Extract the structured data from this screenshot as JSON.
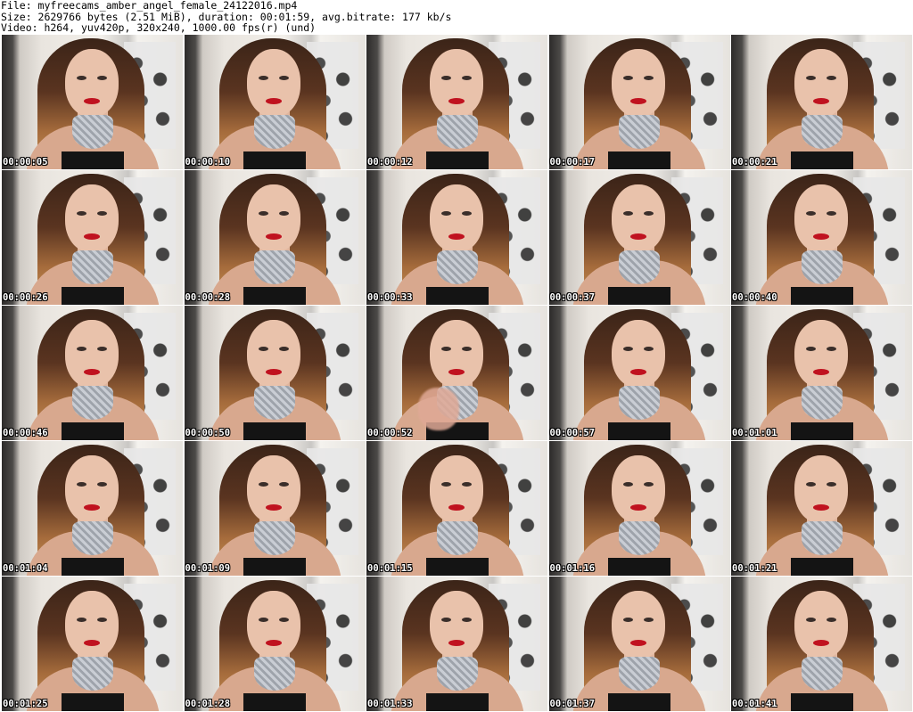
{
  "header": {
    "file_line": "File: myfreecams_amber_angel_female_24122016.mp4",
    "size_line": "Size: 2629766 bytes (2.51 MiB), duration: 00:01:59, avg.bitrate: 177 kb/s",
    "video_line": "Video: h264, yuv420p, 320x240, 1000.00 fps(r) (und)"
  },
  "thumbnails": [
    {
      "timestamp": "00:00:05"
    },
    {
      "timestamp": "00:00:10"
    },
    {
      "timestamp": "00:00:12"
    },
    {
      "timestamp": "00:00:17"
    },
    {
      "timestamp": "00:00:21"
    },
    {
      "timestamp": "00:00:26"
    },
    {
      "timestamp": "00:00:28"
    },
    {
      "timestamp": "00:00:33"
    },
    {
      "timestamp": "00:00:37"
    },
    {
      "timestamp": "00:00:40"
    },
    {
      "timestamp": "00:00:46"
    },
    {
      "timestamp": "00:00:50"
    },
    {
      "timestamp": "00:00:52"
    },
    {
      "timestamp": "00:00:57"
    },
    {
      "timestamp": "00:01:01"
    },
    {
      "timestamp": "00:01:04"
    },
    {
      "timestamp": "00:01:09"
    },
    {
      "timestamp": "00:01:15"
    },
    {
      "timestamp": "00:01:16"
    },
    {
      "timestamp": "00:01:21"
    },
    {
      "timestamp": "00:01:25"
    },
    {
      "timestamp": "00:01:28"
    },
    {
      "timestamp": "00:01:33"
    },
    {
      "timestamp": "00:01:37"
    },
    {
      "timestamp": "00:01:41"
    }
  ]
}
